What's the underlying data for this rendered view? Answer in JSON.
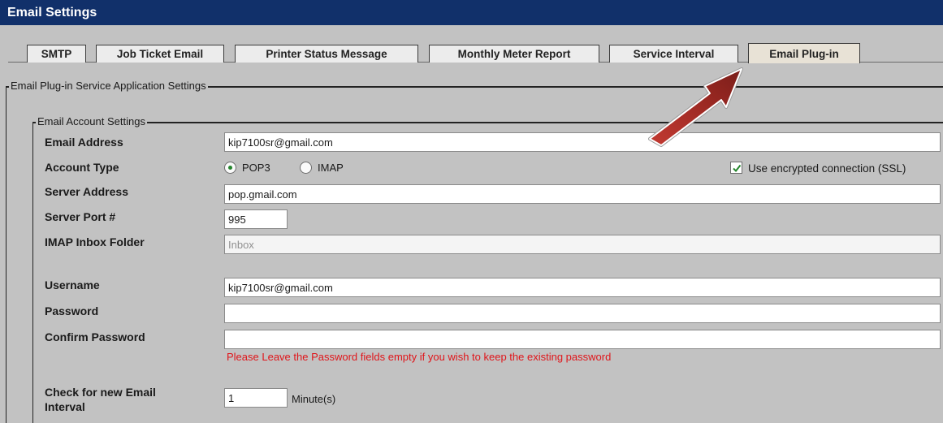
{
  "window": {
    "title": "Email Settings"
  },
  "tabs": [
    {
      "label": "SMTP",
      "active": false
    },
    {
      "label": "Job Ticket Email",
      "active": false
    },
    {
      "label": "Printer Status Message",
      "active": false
    },
    {
      "label": "Monthly Meter Report",
      "active": false
    },
    {
      "label": "Service Interval",
      "active": false
    },
    {
      "label": "Email Plug-in",
      "active": true
    }
  ],
  "outer_group": {
    "legend": "Email Plug-in Service Application Settings"
  },
  "account_group": {
    "legend": "Email Account Settings",
    "email_address": {
      "label": "Email Address",
      "value": "kip7100sr@gmail.com"
    },
    "account_type": {
      "label": "Account Type",
      "options": [
        "POP3",
        "IMAP"
      ],
      "selected": "POP3"
    },
    "ssl": {
      "label": "Use encrypted connection (SSL)",
      "checked": true
    },
    "server_address": {
      "label": "Server Address",
      "value": "pop.gmail.com"
    },
    "server_port": {
      "label": "Server Port #",
      "value": "995"
    },
    "imap_folder": {
      "label": "IMAP Inbox Folder",
      "placeholder": "Inbox"
    },
    "username": {
      "label": "Username",
      "value": "kip7100sr@gmail.com"
    },
    "password": {
      "label": "Password",
      "value": ""
    },
    "confirm_password": {
      "label": "Confirm Password",
      "value": ""
    },
    "password_note": "Please Leave the Password fields empty if you wish to keep the existing password",
    "check_interval": {
      "label_line1": "Check for new Email",
      "label_line2": "Interval",
      "value": "1",
      "unit": "Minute(s)"
    }
  },
  "colors": {
    "title_bar": "#11306a",
    "background": "#c2c2c2",
    "warning_text": "#e0161b",
    "annotation_arrow": "#a8302c"
  },
  "annotation": {
    "icon": "red-arrow-icon",
    "points_to": "Email Plug-in"
  }
}
